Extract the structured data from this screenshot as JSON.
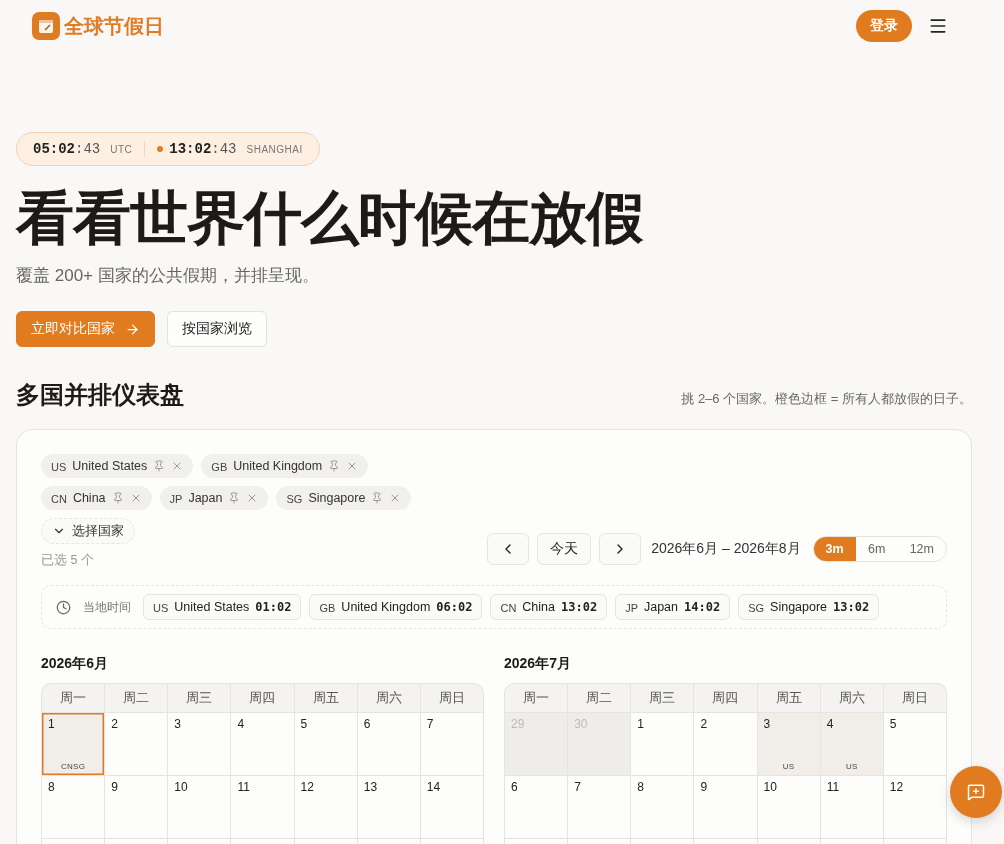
{
  "header": {
    "logo": "全球节假日",
    "login": "登录"
  },
  "clock": [
    {
      "hm": "05:02",
      "sec": ":43",
      "zone": "UTC",
      "dot": false
    },
    {
      "hm": "13:02",
      "sec": ":43",
      "zone": "SHANGHAI",
      "dot": true
    }
  ],
  "hero": {
    "title": "看看世界什么时候在放假",
    "subtitle": "覆盖 200+ 国家的公共假期，并排呈现。",
    "buttons": [
      {
        "label": "立即对比国家",
        "kind": "primary"
      },
      {
        "label": "按国家浏览",
        "kind": "secondary"
      }
    ]
  },
  "dashboard": {
    "title": "多国并排仪表盘",
    "hint": "挑 2–6 个国家。橙色边框 = 所有人都放假的日子。",
    "countries": [
      {
        "code": "US",
        "name": "United States"
      },
      {
        "code": "GB",
        "name": "United Kingdom"
      },
      {
        "code": "CN",
        "name": "China"
      },
      {
        "code": "JP",
        "name": "Japan"
      },
      {
        "code": "SG",
        "name": "Singapore"
      }
    ],
    "select": "选择国家",
    "selected_count": "已选 5 个",
    "nav": {
      "today": "今天",
      "range": "2026年6月 – 2026年8月"
    },
    "ranges": [
      {
        "label": "3m",
        "selected": true
      },
      {
        "label": "6m",
        "selected": false
      },
      {
        "label": "12m",
        "selected": false
      }
    ],
    "local_time": {
      "label": "当地时间",
      "items": [
        {
          "code": "US",
          "name": "United States",
          "time": "01:02"
        },
        {
          "code": "GB",
          "name": "United Kingdom",
          "time": "06:02"
        },
        {
          "code": "CN",
          "name": "China",
          "time": "13:02"
        },
        {
          "code": "JP",
          "name": "Japan",
          "time": "14:02"
        },
        {
          "code": "SG",
          "name": "Singapore",
          "time": "13:02"
        }
      ]
    },
    "months": [
      {
        "title": "2026年6月",
        "weekdays": [
          "周一",
          "周二",
          "周三",
          "周四",
          "周五",
          "周六",
          "周日"
        ],
        "days": [
          {
            "number": "1",
            "outside": false,
            "holiday": true,
            "all_off": true,
            "tags": [
              "CN",
              "SG"
            ]
          },
          {
            "number": "2",
            "outside": false,
            "holiday": false,
            "all_off": false
          },
          {
            "number": "3",
            "outside": false,
            "holiday": false,
            "all_off": false
          },
          {
            "number": "4",
            "outside": false,
            "holiday": false,
            "all_off": false
          },
          {
            "number": "5",
            "outside": false,
            "holiday": false,
            "all_off": false
          },
          {
            "number": "6",
            "outside": false,
            "holiday": false,
            "all_off": false
          },
          {
            "number": "7",
            "outside": false,
            "holiday": false,
            "all_off": false
          },
          {
            "number": "8",
            "outside": false,
            "holiday": false,
            "all_off": false
          },
          {
            "number": "9",
            "outside": false,
            "holiday": false,
            "all_off": false
          },
          {
            "number": "10",
            "outside": false,
            "holiday": false,
            "all_off": false
          },
          {
            "number": "11",
            "outside": false,
            "holiday": false,
            "all_off": false
          },
          {
            "number": "12",
            "outside": false,
            "holiday": false,
            "all_off": false
          },
          {
            "number": "13",
            "outside": false,
            "holiday": false,
            "all_off": false
          },
          {
            "number": "14",
            "outside": false,
            "holiday": false,
            "all_off": false
          }
        ]
      },
      {
        "title": "2026年7月",
        "weekdays": [
          "周一",
          "周二",
          "周三",
          "周四",
          "周五",
          "周六",
          "周日"
        ],
        "days": [
          {
            "number": "29",
            "outside": true,
            "holiday": false,
            "all_off": false
          },
          {
            "number": "30",
            "outside": true,
            "holiday": false,
            "all_off": false
          },
          {
            "number": "1",
            "outside": false,
            "holiday": false,
            "all_off": false
          },
          {
            "number": "2",
            "outside": false,
            "holiday": false,
            "all_off": false
          },
          {
            "number": "3",
            "outside": false,
            "holiday": true,
            "all_off": false,
            "tags": [
              "US"
            ]
          },
          {
            "number": "4",
            "outside": false,
            "holiday": true,
            "all_off": false,
            "tags": [
              "US"
            ]
          },
          {
            "number": "5",
            "outside": false,
            "holiday": false,
            "all_off": false
          },
          {
            "number": "6",
            "outside": false,
            "holiday": false,
            "all_off": false
          },
          {
            "number": "7",
            "outside": false,
            "holiday": false,
            "all_off": false
          },
          {
            "number": "8",
            "outside": false,
            "holiday": false,
            "all_off": false
          },
          {
            "number": "9",
            "outside": false,
            "holiday": false,
            "all_off": false
          },
          {
            "number": "10",
            "outside": false,
            "holiday": false,
            "all_off": false
          },
          {
            "number": "11",
            "outside": false,
            "holiday": false,
            "all_off": false
          },
          {
            "number": "12",
            "outside": false,
            "holiday": false,
            "all_off": false
          }
        ]
      }
    ]
  }
}
